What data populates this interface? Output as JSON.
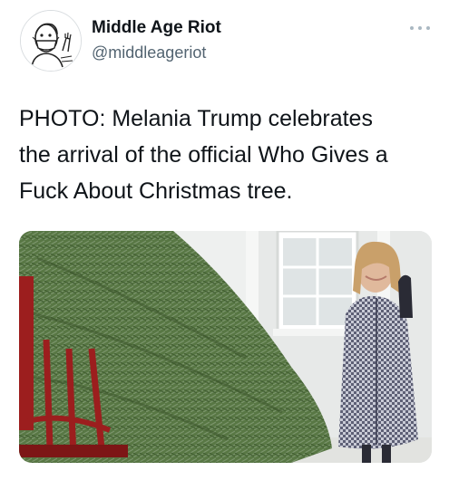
{
  "author": {
    "name": "Middle Age Riot",
    "handle": "@middleageriot",
    "avatar_icon": "cartoon-man-mask-icon"
  },
  "menu": {
    "icon": "more-options-icon"
  },
  "tweet": {
    "text_lines": [
      "PHOTO: Melania Trump celebrates",
      "the arrival of the official Who Gives a",
      "Fuck About Christmas tree."
    ]
  },
  "media": {
    "type": "photo"
  },
  "colors": {
    "text": "#0f1419",
    "secondary": "#536471",
    "tree": "#5a7a44",
    "cart": "#9c1e1e"
  }
}
